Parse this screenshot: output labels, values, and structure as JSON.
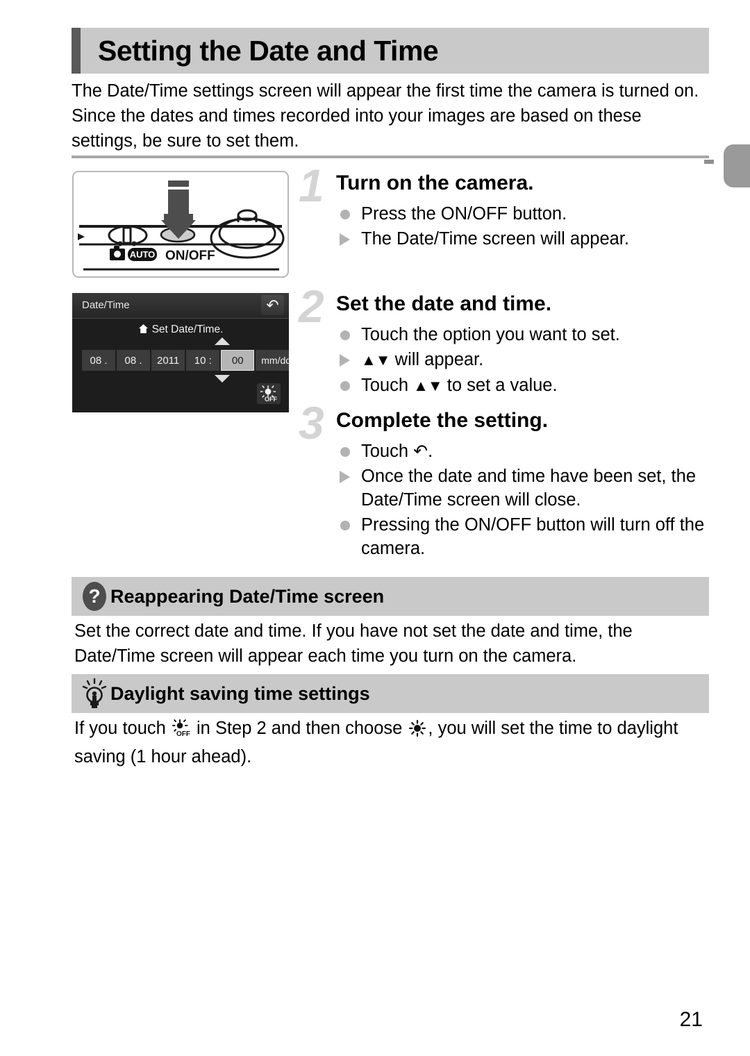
{
  "page": {
    "title": "Setting the Date and Time",
    "number": "21",
    "intro": "The Date/Time settings screen will appear the first time the camera is turned on. Since the dates and times recorded into your images are based on these settings, be sure to set them."
  },
  "figures": {
    "camera": {
      "mode_label": "AUTO",
      "button_label": "ON/OFF",
      "icon_camera": "camera-icon",
      "icon_arrow": "press-down-arrow-icon",
      "icon_dial": "mode-dial-icon",
      "icon_shutter": "shutter-ring-icon"
    },
    "lcd": {
      "screen_title": "Date/Time",
      "return_icon": "return-arrow-icon",
      "set_prompt": "Set Date/Time.",
      "home_icon": "home-icon",
      "fields": [
        {
          "value": "08 .",
          "selected": false
        },
        {
          "value": "08 .",
          "selected": false
        },
        {
          "value": "2011",
          "selected": false
        },
        {
          "value": "10 :",
          "selected": false
        },
        {
          "value": "00",
          "selected": true
        }
      ],
      "format": "mm/dd/yy",
      "arrow_up_icon": "arrow-up-icon",
      "arrow_down_icon": "arrow-down-icon",
      "dst_button_label": "OFF",
      "dst_button_icon": "sun-off-icon"
    }
  },
  "steps": [
    {
      "number": "1",
      "heading": "Turn on the camera.",
      "lines": [
        {
          "marker": "dot",
          "pre": "Press the ON/OFF button.",
          "glyph": "",
          "post": ""
        },
        {
          "marker": "tri",
          "pre": "The Date/Time screen will appear.",
          "glyph": "",
          "post": ""
        }
      ]
    },
    {
      "number": "2",
      "heading": "Set the date and time.",
      "lines": [
        {
          "marker": "dot",
          "pre": "Touch the option you want to set.",
          "glyph": "",
          "post": ""
        },
        {
          "marker": "tri",
          "pre": "",
          "glyph": "▲▼",
          "post": " will appear."
        },
        {
          "marker": "dot",
          "pre": "Touch ",
          "glyph": "▲▼",
          "post": " to set a value."
        }
      ]
    },
    {
      "number": "3",
      "heading": "Complete the setting.",
      "lines": [
        {
          "marker": "dot",
          "pre": "Touch ",
          "glyph": "↶",
          "post": "."
        },
        {
          "marker": "tri",
          "pre": "Once the date and time have been set, the Date/Time screen will close.",
          "glyph": "",
          "post": ""
        },
        {
          "marker": "dot",
          "pre": "Pressing the ON/OFF button will turn off the camera.",
          "glyph": "",
          "post": ""
        }
      ]
    }
  ],
  "callouts": [
    {
      "icon": "question-mark-icon",
      "title": "Reappearing Date/Time screen",
      "text": "Set the correct date and time. If you have not set the date and time, the Date/Time screen will appear each time you turn on the camera."
    },
    {
      "icon": "lightbulb-icon",
      "title": "Daylight saving time settings",
      "text_part1": "If you touch ",
      "inline_icon_1": "sun-off-icon",
      "text_part2": " in Step 2 and then choose ",
      "inline_icon_2": "sun-icon",
      "text_part3": ", you will set the time to daylight saving (1 hour ahead)."
    }
  ],
  "colors": {
    "header_bg": "#c9c9c9",
    "header_accent": "#5a5a5a",
    "step_number": "#d4d4d4",
    "marker": "#b2b2b2",
    "lcd_bg": "#1d1d1d",
    "tab_marker": "#9a9a9a"
  }
}
